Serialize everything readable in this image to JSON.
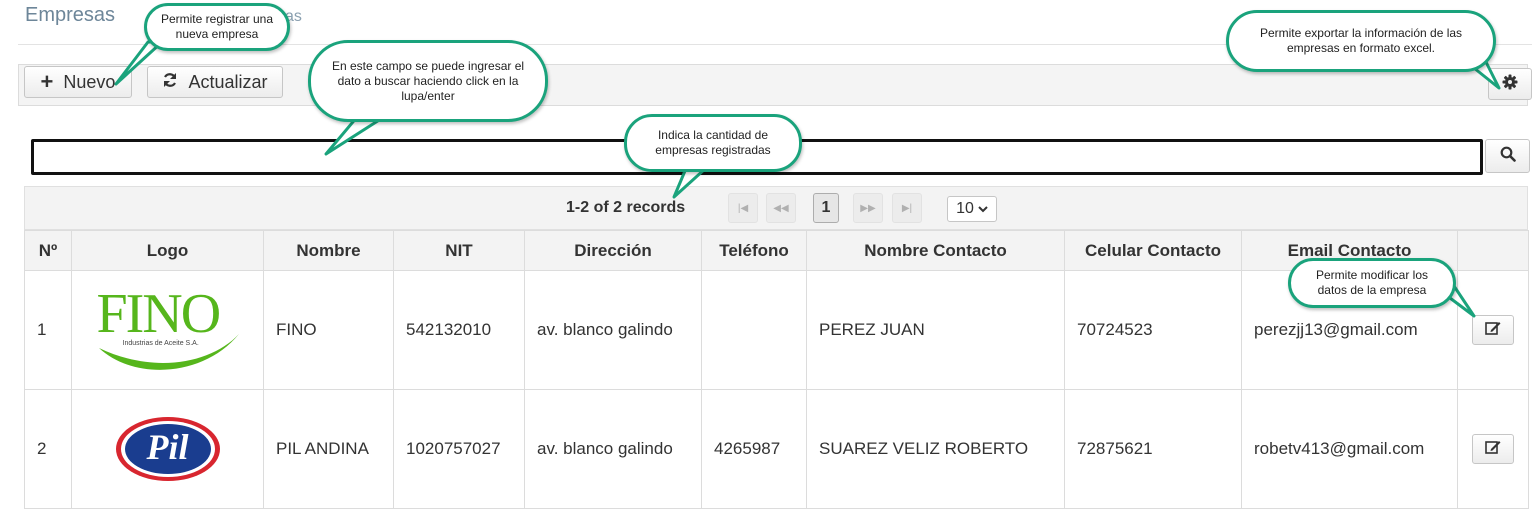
{
  "header": {
    "title": "Empresas",
    "crumb": "as"
  },
  "toolbar": {
    "new_label": "Nuevo",
    "refresh_label": "Actualizar",
    "settings_icon": "gear-icon"
  },
  "search": {
    "value": "",
    "placeholder": "",
    "button_icon": "search-icon"
  },
  "paginator": {
    "info": "1-2 of 2 records",
    "current_page": "1",
    "rows_per_page": "10"
  },
  "table": {
    "columns": [
      "Nº",
      "Logo",
      "Nombre",
      "NIT",
      "Dirección",
      "Teléfono",
      "Nombre Contacto",
      "Celular Contacto",
      "Email Contacto",
      ""
    ],
    "rows": [
      {
        "num": "1",
        "logo": {
          "text": "FINO",
          "subtext": "Industrias de Aceite S.A."
        },
        "nombre": "FINO",
        "nit": "542132010",
        "direccion": "av. blanco galindo",
        "telefono": "",
        "contacto": "PEREZ JUAN",
        "celular": "70724523",
        "email": "perezjj13@gmail.com"
      },
      {
        "num": "2",
        "logo": {
          "text": "Pil"
        },
        "nombre": "PIL ANDINA",
        "nit": "1020757027",
        "direccion": "av. blanco galindo",
        "telefono": "4265987",
        "contacto": "SUAREZ VELIZ ROBERTO",
        "celular": "72875621",
        "email": "robetv413@gmail.com"
      }
    ]
  },
  "callouts": {
    "nuevo": "Permite registrar una nueva empresa",
    "search": "En este campo se puede ingresar el dato a buscar haciendo click en la lupa/enter",
    "count": "Indica la cantidad de empresas registradas",
    "export": "Permite exportar la información de las empresas en formato excel.",
    "edit": "Permite  modificar los datos de la empresa"
  },
  "colors": {
    "callout_border": "#1aa37c",
    "fino_green": "#56b61c",
    "pil_blue": "#1a3d8f",
    "pil_red": "#d8262f"
  }
}
